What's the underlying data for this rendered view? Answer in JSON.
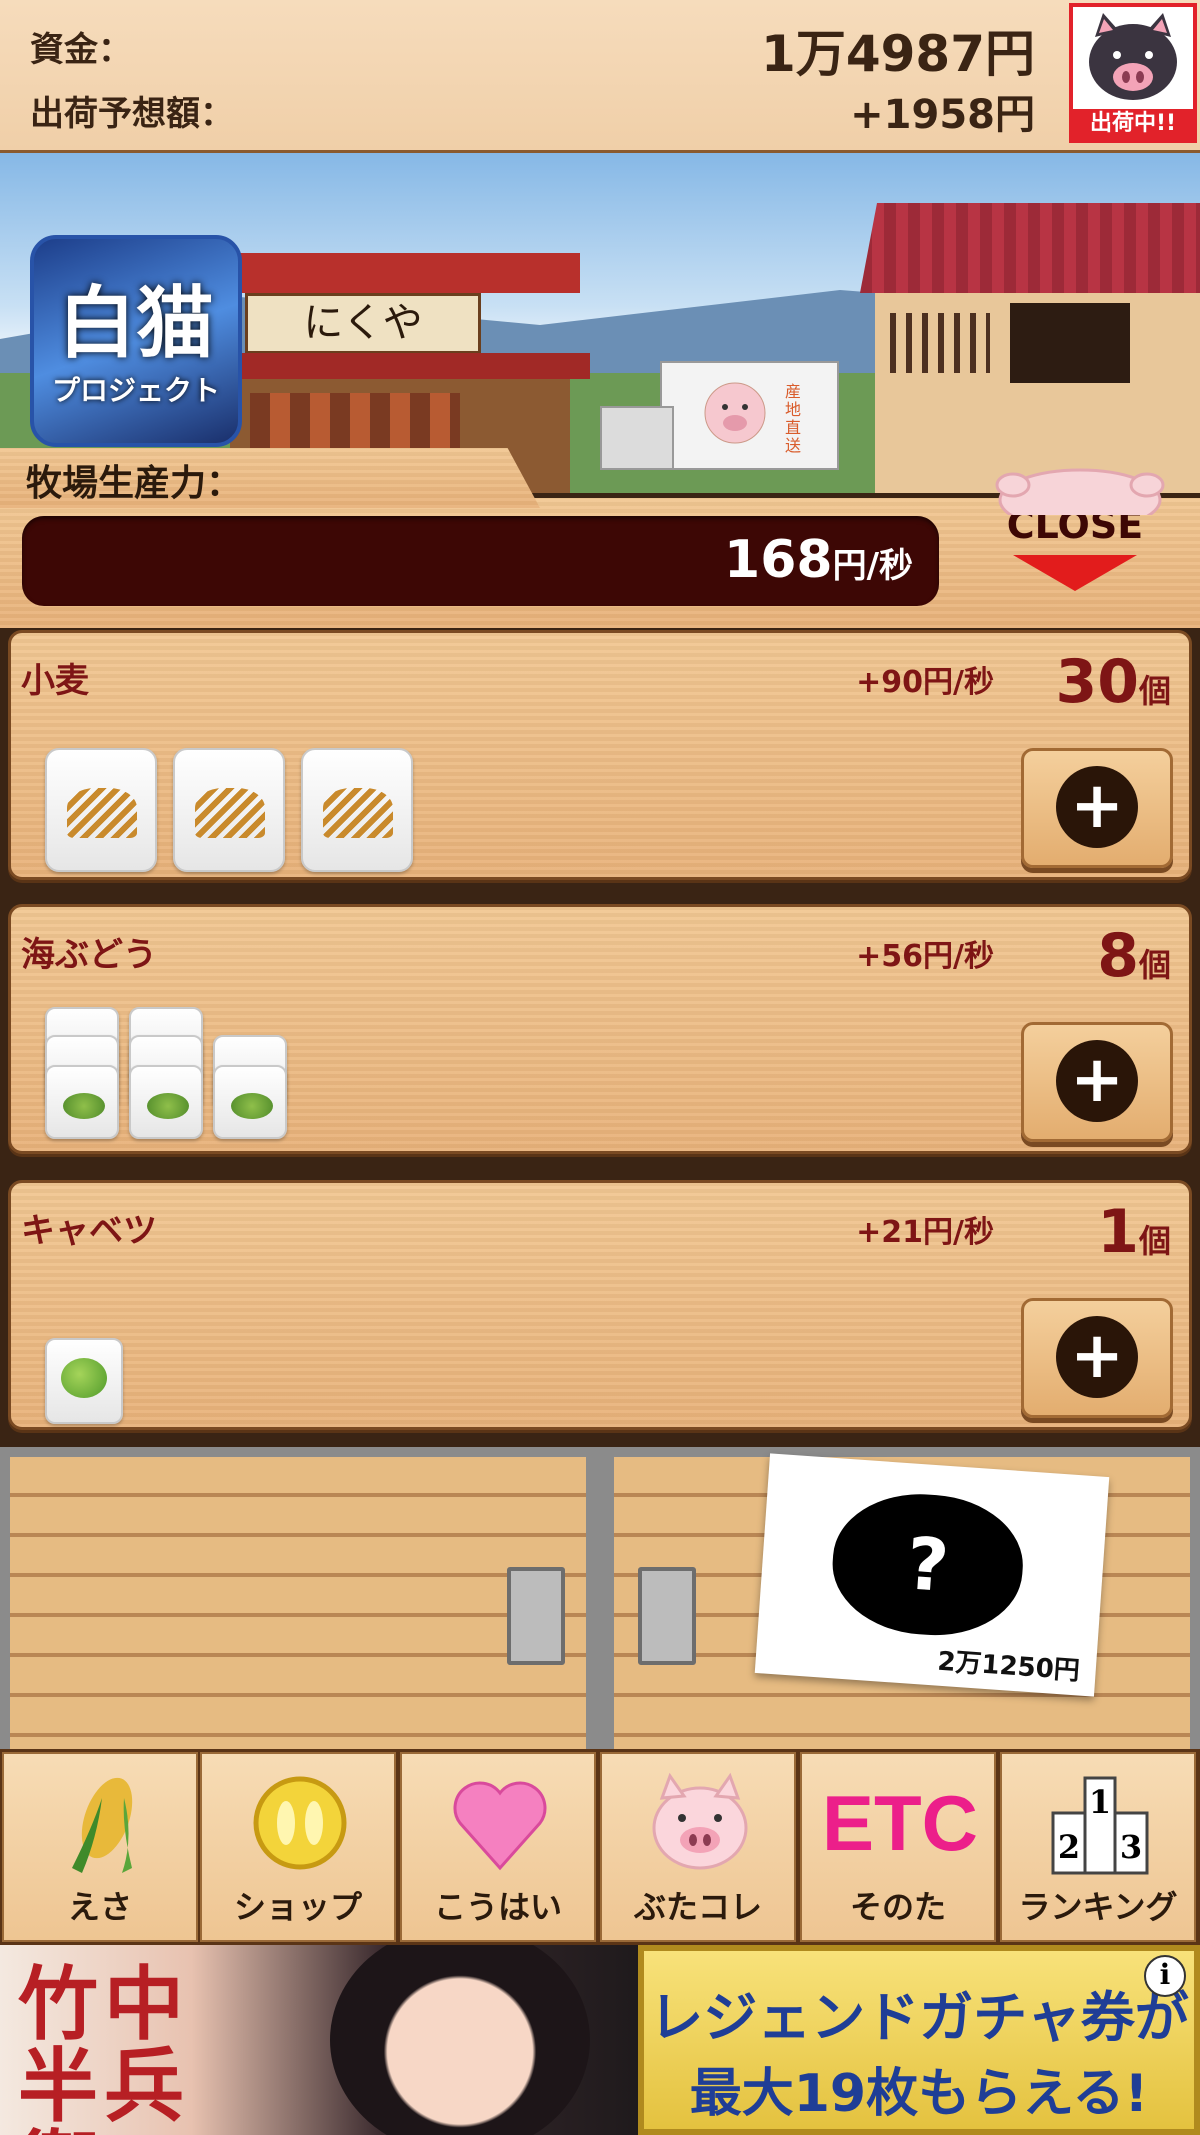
{
  "header": {
    "money_label": "資金：",
    "money_value": "1万4987円",
    "forecast_label": "出荷予想額：",
    "forecast_value": "+1958円",
    "shipping_badge": "出荷中!!"
  },
  "scene": {
    "shop_sign": "にくや",
    "truck_text": "産地直送",
    "app_icon": {
      "line1": "白猫",
      "line2": "プロジェクト"
    }
  },
  "production": {
    "label": "牧場生産力：",
    "value": "168",
    "unit": "円/秒",
    "close_label": "CLOSE"
  },
  "items": [
    {
      "name": "小麦",
      "rate": "+90円/秒",
      "count": "30",
      "count_unit": "個"
    },
    {
      "name": "海ぶどう",
      "rate": "+56円/秒",
      "count": "8",
      "count_unit": "個"
    },
    {
      "name": "キャベツ",
      "rate": "+21円/秒",
      "count": "1",
      "count_unit": "個"
    }
  ],
  "mystery": {
    "symbol": "?",
    "price": "2万1250円"
  },
  "nav": [
    {
      "label": "えさ",
      "icon": "corn-icon"
    },
    {
      "label": "ショップ",
      "icon": "coin-icon"
    },
    {
      "label": "こうはい",
      "icon": "heart-icon"
    },
    {
      "label": "ぶたコレ",
      "icon": "pig-icon"
    },
    {
      "label": "そのた",
      "icon": "etc-icon",
      "icon_text": "ETC"
    },
    {
      "label": "ランキング",
      "icon": "podium-icon"
    }
  ],
  "banner": {
    "left_text": "竹中半兵衛",
    "right_line1": "レジェンドガチャ券が",
    "right_line2": "最大19枚もらえる!",
    "info_icon": "i"
  },
  "colors": {
    "accent_red": "#7e1515",
    "bar_bg": "#3d0705",
    "badge_red": "#e2222a"
  }
}
